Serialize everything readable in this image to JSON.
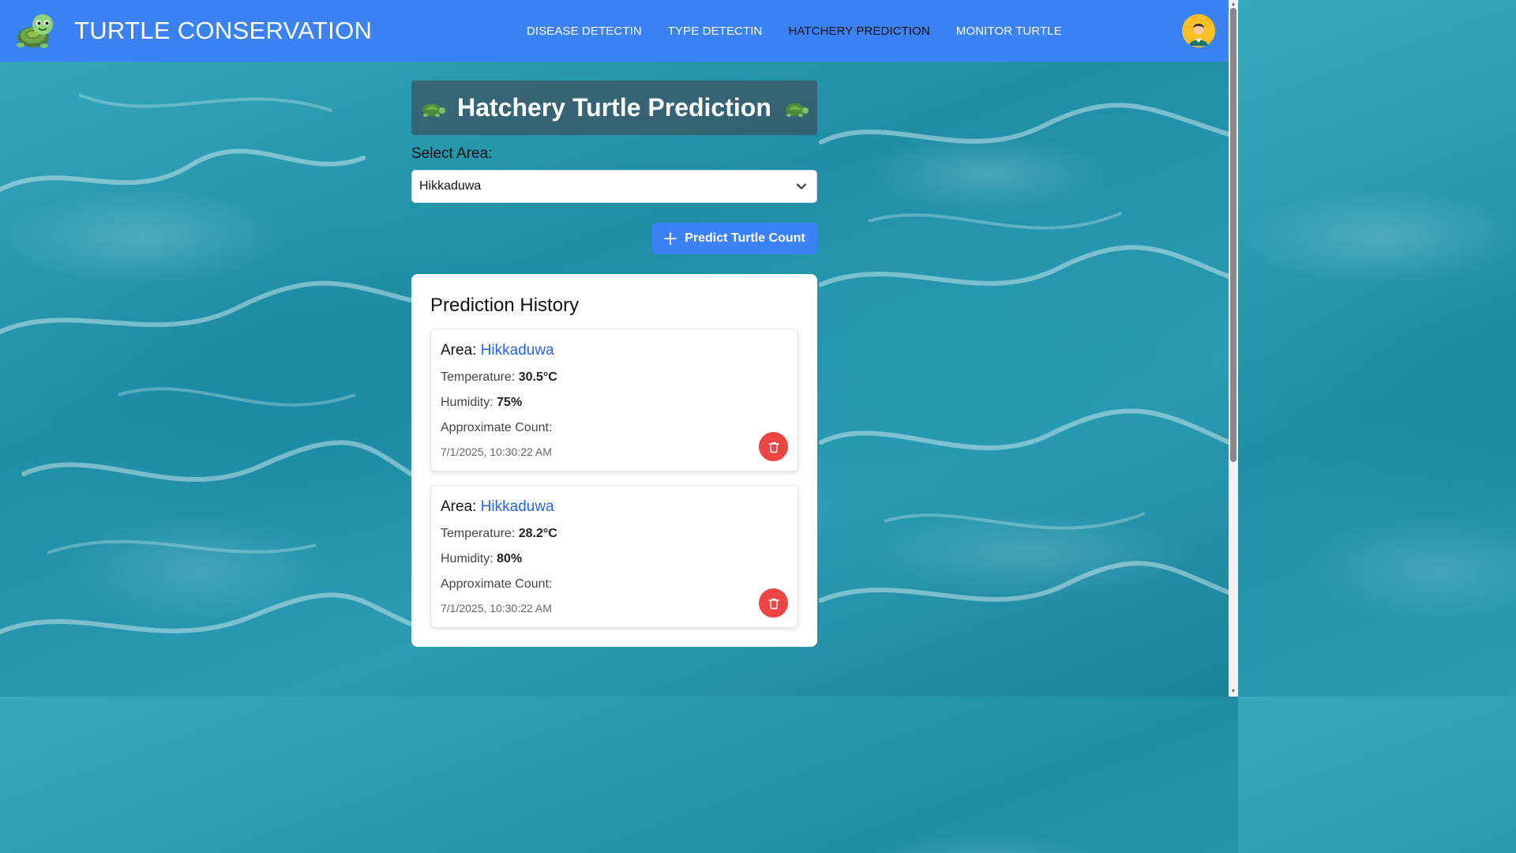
{
  "app": {
    "title": "TURTLE CONSERVATION"
  },
  "nav": {
    "items": [
      {
        "label": "DISEASE DETECTIN"
      },
      {
        "label": "TYPE DETECTIN"
      },
      {
        "label": "HATCHERY PREDICTION"
      },
      {
        "label": "MONITOR TURTLE"
      }
    ],
    "active_index": 2
  },
  "page": {
    "title": "Hatchery Turtle Prediction"
  },
  "area_select": {
    "label": "Select Area:",
    "value": "Hikkaduwa"
  },
  "predict_button": {
    "label": "Predict Turtle Count"
  },
  "history": {
    "title": "Prediction History",
    "area_label": "Area:",
    "temperature_label": "Temperature:",
    "humidity_label": "Humidity:",
    "count_label": "Approximate Count:",
    "items": [
      {
        "area": "Hikkaduwa",
        "temperature": "30.5°C",
        "humidity": "75%",
        "timestamp": "7/1/2025, 10:30:22 AM"
      },
      {
        "area": "Hikkaduwa",
        "temperature": "28.2°C",
        "humidity": "80%",
        "timestamp": "7/1/2025, 10:30:22 AM"
      }
    ]
  },
  "colors": {
    "navbar": "#3b82f6",
    "accent": "#2563eb",
    "delete": "#ef4444",
    "avatar_bg": "#fbbf24"
  },
  "icons": {
    "logo": "turtle-logo-icon",
    "title_decoration": "turtle-icon",
    "select": "chevron-down-icon",
    "predict": "plus-icon",
    "delete": "trash-icon",
    "user": "user-avatar-icon"
  }
}
